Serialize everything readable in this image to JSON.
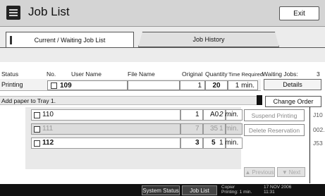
{
  "title": "Job List",
  "exit_label": "Exit",
  "tabs": [
    "Current / Waiting Job List",
    "Job History"
  ],
  "columns": {
    "status": "Status",
    "no": "No.",
    "user_name": "User Name",
    "file_name": "File Name",
    "original": "Original",
    "quantity": "Quantity",
    "time_required": "Time Required",
    "waiting_jobs_label": "Waiting Jobs:",
    "waiting_jobs_count": "3"
  },
  "printing": {
    "status": "Printing",
    "no": "109",
    "original": "1",
    "quantity": "20",
    "time": "1 min."
  },
  "details_label": "Details",
  "add_paper": "Add paper to Tray 1.",
  "change_order_label": "Change Order",
  "jobs": [
    {
      "no": "110",
      "original": "1",
      "quantity": "A0",
      "time": "2 min."
    },
    {
      "no": "111",
      "original": "7",
      "quantity": "35",
      "time": "1 min."
    },
    {
      "no": "112",
      "original": "3",
      "quantity": "5",
      "time": "1 min."
    }
  ],
  "suspend_label": "Suspend Printing",
  "delete_label": "Delete Reservation",
  "side_codes": [
    "J10",
    "002.",
    "J53"
  ],
  "previous_label": "Previous",
  "next_label": "Next",
  "bottom": {
    "system_status": "System Status",
    "job_list": "Job List",
    "copier": "Copier",
    "printing_line": "Printing: 1 min.",
    "date": "17 NOV   2006",
    "time": "11:31"
  }
}
